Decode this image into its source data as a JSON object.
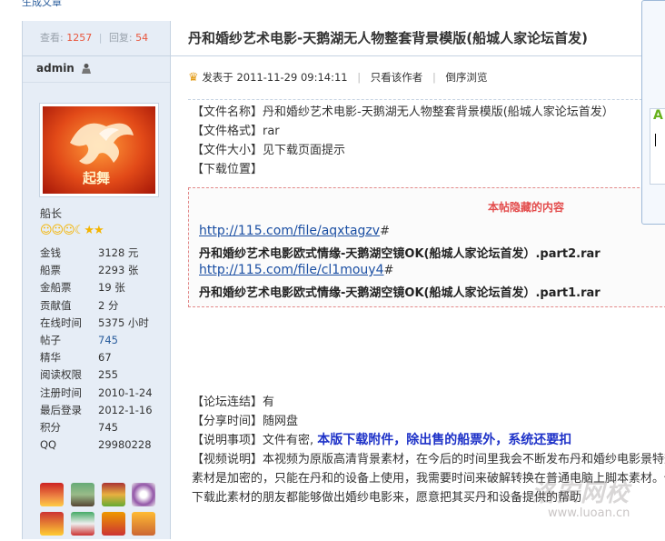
{
  "top_link": "生成文章",
  "stats": {
    "views_label": "查看:",
    "views": "1257",
    "replies_label": "回复:",
    "replies": "54"
  },
  "author": {
    "name": "admin",
    "rank": "船长"
  },
  "user_info": [
    {
      "k": "金钱",
      "v": "3128 元"
    },
    {
      "k": "船票",
      "v": "2293 张"
    },
    {
      "k": "金船票",
      "v": "19 张"
    },
    {
      "k": "贡献值",
      "v": "2 分"
    },
    {
      "k": "在线时间",
      "v": "5375 小时"
    },
    {
      "k": "帖子",
      "v": "745"
    },
    {
      "k": "精华",
      "v": "67"
    },
    {
      "k": "阅读权限",
      "v": "255"
    },
    {
      "k": "注册时间",
      "v": "2010-1-24"
    },
    {
      "k": "最后登录",
      "v": "2012-1-16"
    },
    {
      "k": "积分",
      "v": "745"
    },
    {
      "k": "QQ",
      "v": "29980228"
    }
  ],
  "post": {
    "title": "丹和婚纱艺术电影-天鹅湖无人物整套背景模版(船城人家论坛首发)",
    "posted_on": "发表于 2011-11-29 09:14:11",
    "only_author": "只看该作者",
    "reverse_browse": "倒序浏览",
    "body_lines": [
      "【文件名称】丹和婚纱艺术电影-天鹅湖无人物整套背景模版(船城人家论坛首发）",
      "【文件格式】rar",
      "【文件大小】见下载页面提示",
      "【下载位置】"
    ],
    "hidden": {
      "header": "本帖隐藏的内容",
      "url1": "http://115.com/file/aqxtagzv",
      "url1_suffix": "#",
      "file1": "丹和婚纱艺术电影欧式情缘-天鹅湖空镜OK(船城人家论坛首发）.part2.rar",
      "url2": "http://115.com/file/cl1mouy4",
      "url2_suffix": "#",
      "file2": "丹和婚纱艺术电影欧式情缘-天鹅湖空镜OK(船城人家论坛首发）.part1.rar"
    },
    "lower": {
      "forum_link": "【论坛连结】有",
      "share_time": "【分享时间】随网盘",
      "notice_prefix": "【说明事项】文件有密,",
      "notice_big": "本版下载附件，除出售的船票外，系统还要扣",
      "video_desc": "【视频说明】本视频为原版高清背景素材，在今后的时间里我会不断发布丹和婚纱电影景特效素材是加密的，只能在丹和的设备上使用，我需要时间来破解转换在普通电脑上脚本素材。使下载此素材的朋友都能够做出婚纱电影来，愿意把其买丹和设备提供的帮助"
    }
  },
  "watermark": {
    "brand": "洛安网校",
    "site": "www.luoan.cn"
  },
  "colors": {
    "accent_red": "#e8563d",
    "link_blue": "#2a5d9c",
    "notice_blue": "#1e32c8"
  }
}
